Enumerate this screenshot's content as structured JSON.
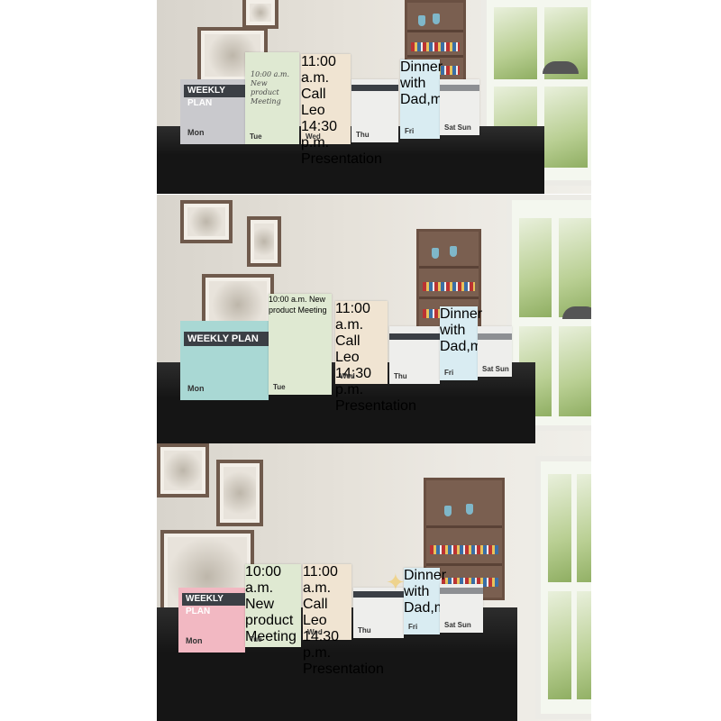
{
  "panels": [
    {
      "colour": "#c9c9cd",
      "title": "WEEKLY PLAN",
      "days": [
        "Mon",
        "Tue",
        "Wed",
        "Thu",
        "Fri",
        "Sat Sun"
      ],
      "notes": {
        "tue": "10:00 a.m.\nNew product\nMeeting",
        "wed": "11:00 a.m.\nCall Leo\n14:30 p.m.\nPresentation",
        "fri": "Dinner\nwith\nDad,mom"
      }
    },
    {
      "colour": "#a9d8d4",
      "title": "WEEKLY PLAN",
      "days": [
        "Mon",
        "Tue",
        "Wed",
        "Thu",
        "Fri",
        "Sat Sun"
      ],
      "notes": {
        "tue": "10:00 a.m.\nNew product\nMeeting",
        "wed": "11:00 a.m.\nCall Leo\n14:30 p.m.\nPresentation",
        "fri": "Dinner\nwith\nDad,mom"
      }
    },
    {
      "colour": "#f2b8c2",
      "title": "WEEKLY PLAN",
      "days": [
        "Mon",
        "Tue",
        "Wed",
        "Thu",
        "Fri",
        "Sat Sun"
      ],
      "notes": {
        "tue": "10:00 a.m.\nNew product\nMeeting",
        "wed": "11:00 a.m.\nCall Leo\n14:30 p.m.\nPresentation",
        "fri": "Dinner\nwith\nDad,mom"
      }
    }
  ],
  "colors": {
    "tue_note": "#dfe9d2",
    "wed_note": "#f0e4d2",
    "fri_note": "#d9ecf2",
    "monitor": "#151515"
  }
}
